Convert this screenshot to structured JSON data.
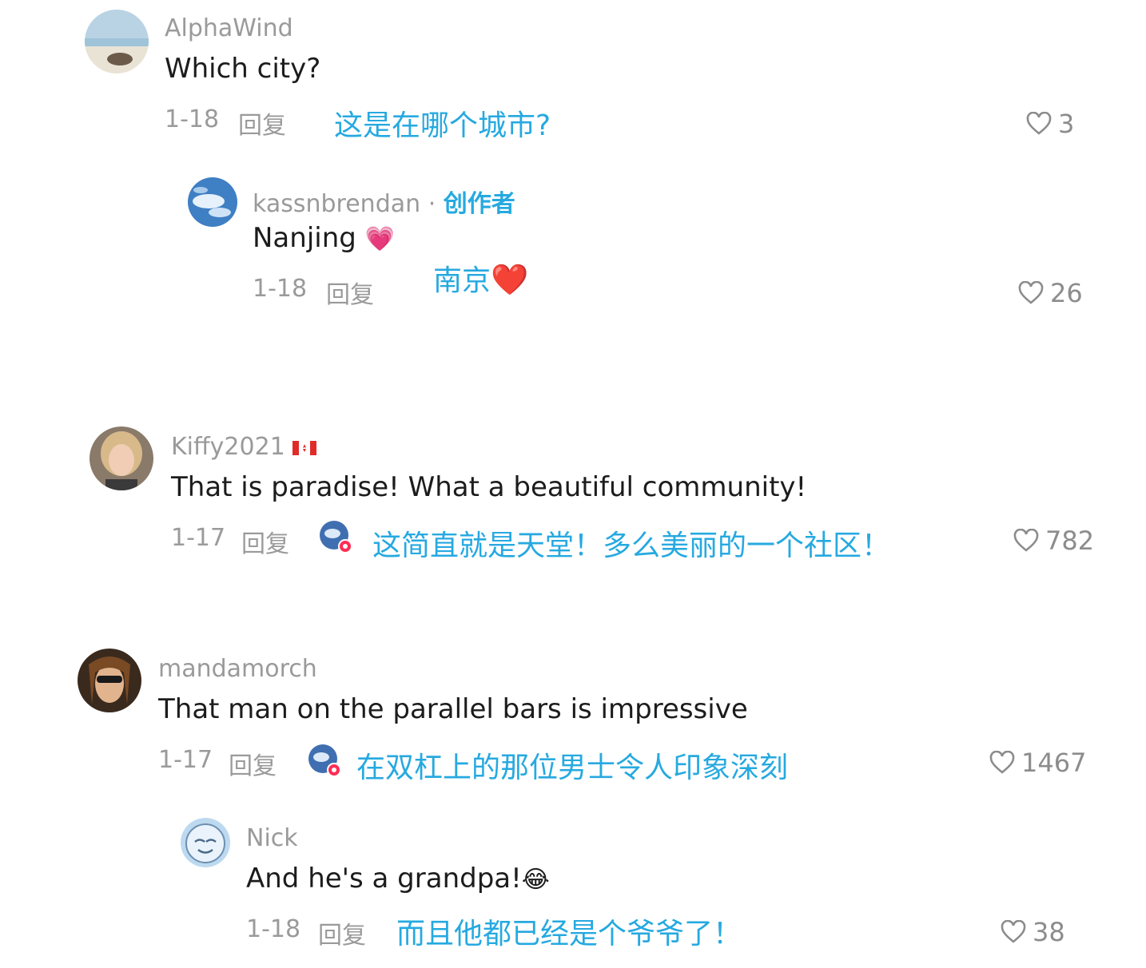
{
  "comments": [
    {
      "username": "AlphaWind",
      "text": "Which city?",
      "date": "1-18",
      "reply_label": "回复",
      "translation": "这是在哪个城市?",
      "likes": "3",
      "avatar_icon": "beach-avatar"
    },
    {
      "username": "kassnbrendan",
      "separator": "·",
      "creator_label": "创作者",
      "text": "Nanjing",
      "text_emoji": "💗",
      "date": "1-18",
      "reply_label": "回复",
      "translation": "南京",
      "translation_emoji": "❤️",
      "likes": "26",
      "avatar_icon": "sky-avatar"
    },
    {
      "username": "Kiffy2021",
      "flag_icon": "canada-flag-icon",
      "text": "That is paradise! What a beautiful community!",
      "date": "1-17",
      "reply_label": "回复",
      "translation": "这简直就是天堂！多么美丽的一个社区！",
      "likes": "782",
      "avatar_icon": "woman-blonde-avatar"
    },
    {
      "username": "mandamorch",
      "text": "That man on the parallel bars is impressive",
      "date": "1-17",
      "reply_label": "回复",
      "translation": "在双杠上的那位男士令人印象深刻",
      "likes": "1467",
      "avatar_icon": "woman-sunglasses-avatar"
    },
    {
      "username": "Nick",
      "text": "And he's a grandpa!",
      "text_emoji": "😂",
      "date": "1-18",
      "reply_label": "回复",
      "translation": "而且他都已经是个爷爷了！",
      "likes": "38",
      "avatar_icon": "cartoon-face-avatar"
    }
  ],
  "colors": {
    "translation": "#26a9e0",
    "meta": "#9a9a9a",
    "text": "#1c1c1c"
  }
}
